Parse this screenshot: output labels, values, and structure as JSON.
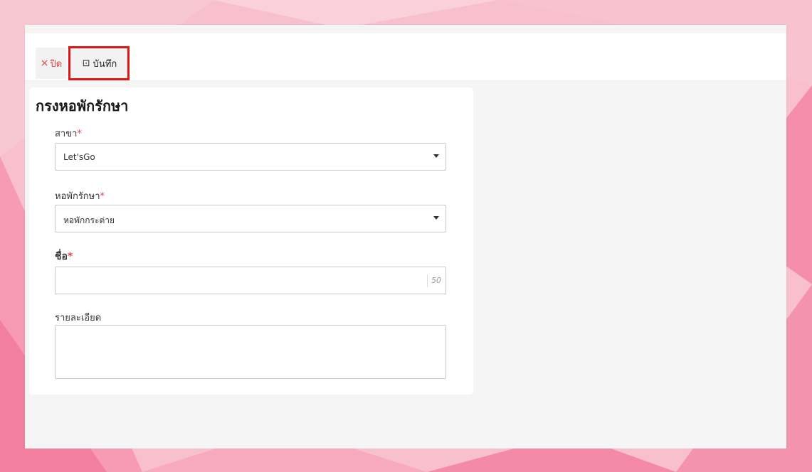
{
  "toolbar": {
    "close_icon_glyph": "×",
    "close_label": "ปิด",
    "save_icon_glyph": "⊡",
    "save_label": "บันทึก"
  },
  "form": {
    "title": "กรงหอพักรักษา",
    "branch": {
      "label": "สาขา",
      "required": "*",
      "value": "Let'sGo"
    },
    "ward": {
      "label": "หอพักรักษา",
      "required": "*",
      "value": "หอพักกระต่าย"
    },
    "name": {
      "label": "ชื่อ",
      "required": "*",
      "value": "",
      "max_length_counter": "50"
    },
    "details": {
      "label": "รายละเอียด",
      "value": ""
    }
  },
  "colors": {
    "required": "#e0454a",
    "highlight": "#e31414",
    "background": "#f7b3c4"
  }
}
